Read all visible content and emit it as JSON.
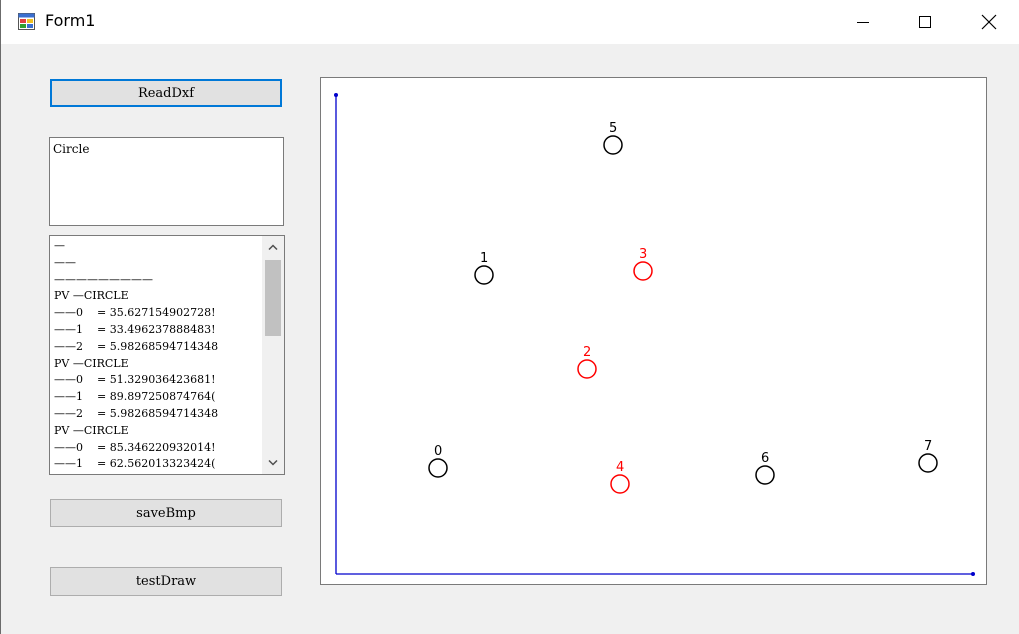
{
  "window": {
    "title": "Form1",
    "icons": {
      "app": "form-app-icon",
      "minimize": "minimize-icon",
      "maximize": "maximize-icon",
      "close": "close-icon"
    }
  },
  "buttons": {
    "read_dxf": "ReadDxf",
    "save_bmp": "saveBmp",
    "test_draw": "testDraw"
  },
  "textbox": {
    "value": "Circle"
  },
  "listbox": {
    "lines": [
      "—",
      "——",
      "—————————",
      "PV —CIRCLE",
      "——0    = 35.627154902728!",
      "——1    = 33.496237888483!",
      "——2    = 5.98268594714348",
      "PV —CIRCLE",
      "——0    = 51.329036423681!",
      "——1    = 89.897250874764(",
      "——2    = 5.98268594714348",
      "PV —CIRCLE",
      "——0    = 85.346220932014!",
      "——1    = 62.562013323424("
    ],
    "scroll_icons": {
      "up": "scroll-up-icon",
      "down": "scroll-down-icon"
    }
  },
  "drawing": {
    "axis_color": "#0000cc",
    "colors": {
      "black": "#000000",
      "red": "#ff0000"
    },
    "circles": [
      {
        "label": "0",
        "color": "black"
      },
      {
        "label": "1",
        "color": "black"
      },
      {
        "label": "2",
        "color": "red"
      },
      {
        "label": "3",
        "color": "red"
      },
      {
        "label": "4",
        "color": "red"
      },
      {
        "label": "5",
        "color": "black"
      },
      {
        "label": "6",
        "color": "black"
      },
      {
        "label": "7",
        "color": "black"
      }
    ]
  }
}
